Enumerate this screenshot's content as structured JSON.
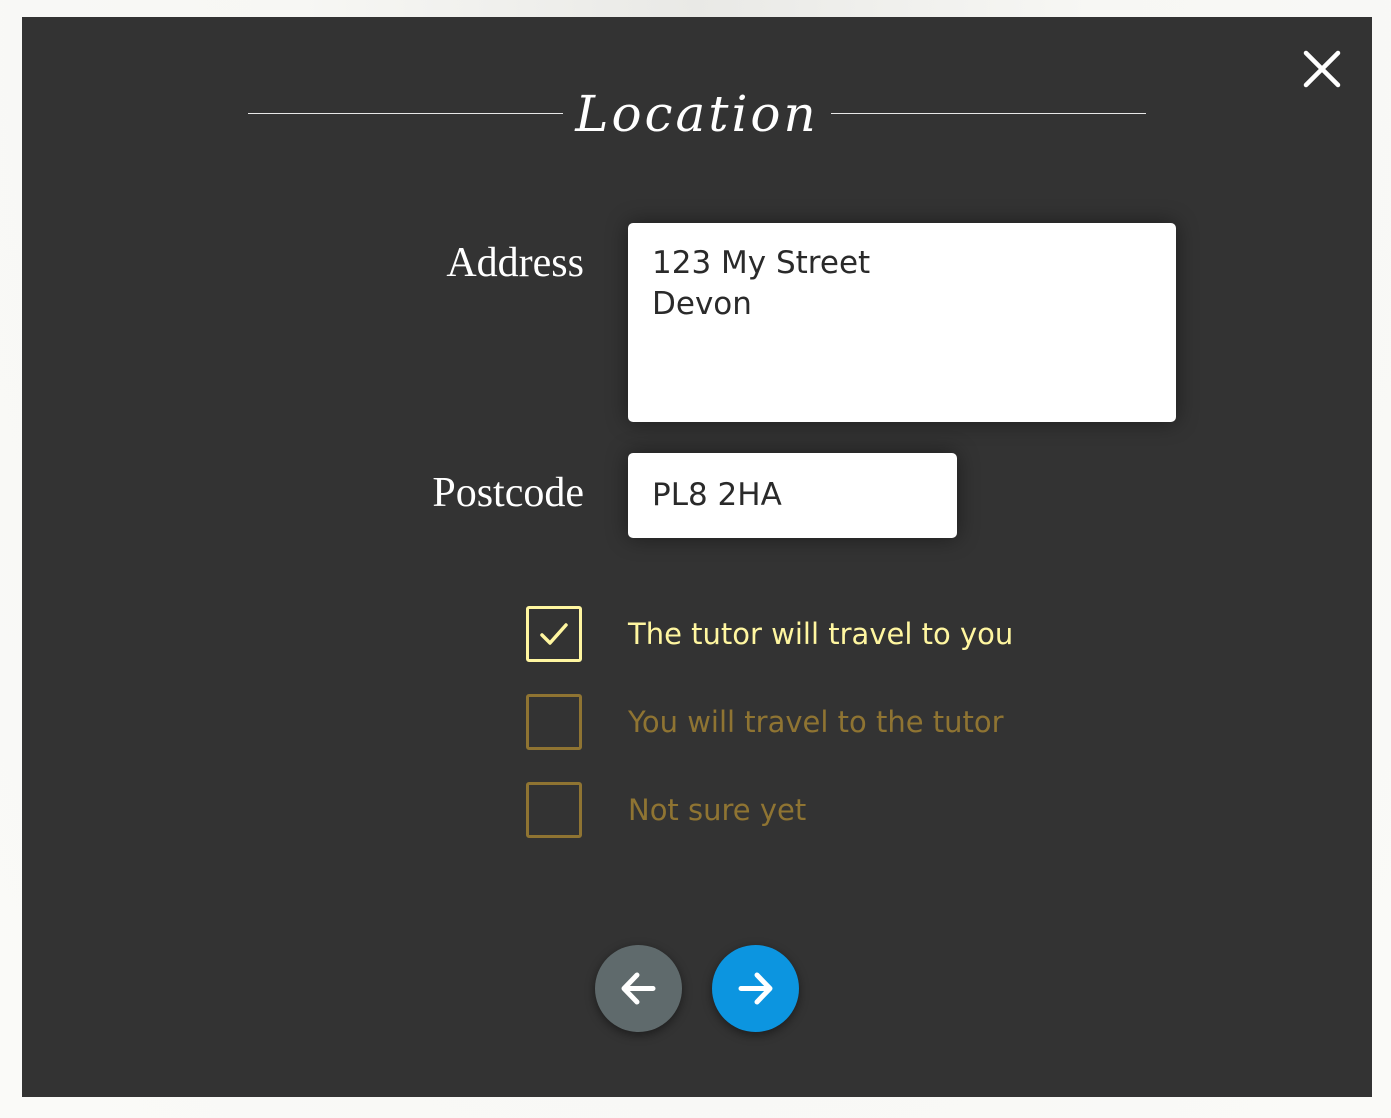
{
  "modal": {
    "title": "Location",
    "close_icon": "close-icon"
  },
  "form": {
    "address_label": "Address",
    "address_lines": [
      "123 My Street",
      "Devon"
    ],
    "postcode_label": "Postcode",
    "postcode_value": "PL8 2HA"
  },
  "travel_options": [
    {
      "label": "The tutor will travel to you",
      "checked": true
    },
    {
      "label": "You will travel to the tutor",
      "checked": false
    },
    {
      "label": "Not sure yet",
      "checked": false
    }
  ],
  "navigation": {
    "back_icon": "arrow-left-icon",
    "next_icon": "arrow-right-icon"
  },
  "colors": {
    "modal_background": "#333333",
    "checked_accent": "#fff6a0",
    "unchecked_accent": "#8f7432",
    "back_button": "#5f6a6c",
    "next_button": "#0c95e0"
  }
}
